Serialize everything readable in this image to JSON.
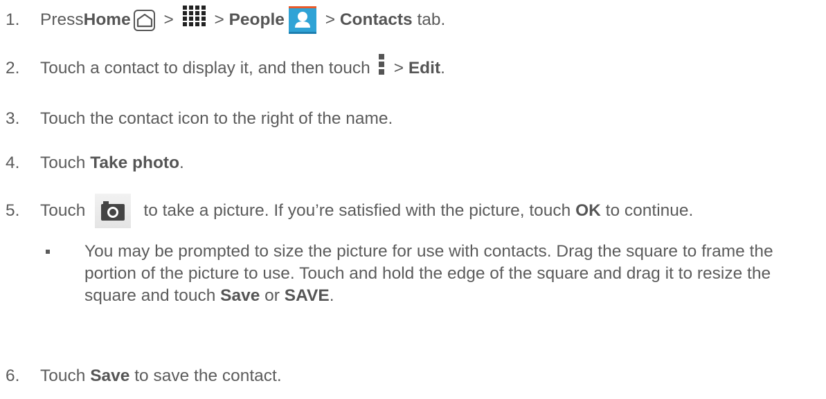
{
  "steps": {
    "s1": {
      "num": "1.",
      "t1": "Press ",
      "home": "Home",
      "gt1": " > ",
      "gt2": " > ",
      "people": "People",
      "gt3": " > ",
      "contacts": "Contacts",
      "t2": " tab."
    },
    "s2": {
      "num": "2.",
      "t1": "Touch a contact to display it, and then touch",
      "gt": "> ",
      "edit": "Edit",
      "t2": "."
    },
    "s3": {
      "num": "3.",
      "t1": "Touch the contact icon to the right of the name."
    },
    "s4": {
      "num": "4.",
      "t1": "Touch ",
      "take": "Take photo",
      "t2": "."
    },
    "s5": {
      "num": "5.",
      "t1": "Touch",
      "t2": "to take a picture. If you’re satisfied with the picture, touch ",
      "ok": "OK",
      "t3": " to continue."
    },
    "sub": {
      "t1": "You may be prompted to size the picture for use with contacts. Drag the square to frame the portion of the picture to use. Touch and hold the edge of the square and drag it to resize the square and touch ",
      "save1": "Save",
      "or": " or ",
      "save2": "SAVE",
      "t2": "."
    },
    "s6": {
      "num": "6.",
      "t1": "Touch ",
      "save": "Save",
      "t2": " to save the contact."
    }
  },
  "icons": {
    "home": "home-icon",
    "apps": "apps-grid-icon",
    "people": "people-app-icon",
    "menu": "menu-dots-icon",
    "camera": "camera-shutter-icon"
  },
  "colors": {
    "text": "#5b5b5b",
    "bold": "#555555",
    "people_bg": "#2fa3d6",
    "camera_bg": "#ececec"
  }
}
